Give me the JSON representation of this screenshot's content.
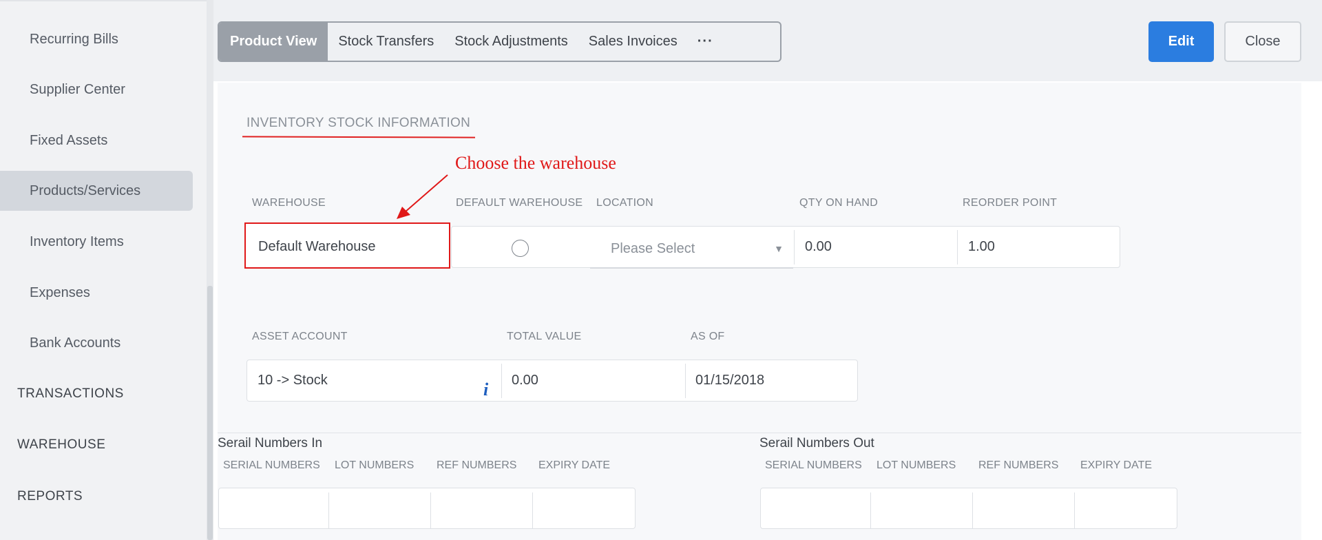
{
  "sidebar": {
    "items": [
      {
        "label": "Recurring Bills"
      },
      {
        "label": "Supplier Center"
      },
      {
        "label": "Fixed Assets"
      },
      {
        "label": "Products/Services"
      },
      {
        "label": "Inventory Items"
      },
      {
        "label": "Expenses"
      },
      {
        "label": "Bank Accounts"
      }
    ],
    "sections": [
      {
        "label": "TRANSACTIONS"
      },
      {
        "label": "WAREHOUSE"
      },
      {
        "label": "REPORTS"
      }
    ]
  },
  "tabs": [
    {
      "label": "Product View",
      "active": true
    },
    {
      "label": "Stock Transfers"
    },
    {
      "label": "Stock Adjustments"
    },
    {
      "label": "Sales Invoices"
    },
    {
      "label": "···"
    }
  ],
  "actions": {
    "edit_label": "Edit",
    "close_label": "Close"
  },
  "inventory": {
    "title": "INVENTORY STOCK INFORMATION",
    "annotation": "Choose the warehouse",
    "columns": {
      "warehouse": "WAREHOUSE",
      "default_warehouse": "DEFAULT WAREHOUSE",
      "location": "LOCATION",
      "qty_on_hand": "QTY ON HAND",
      "reorder_point": "REORDER POINT"
    },
    "row": {
      "warehouse": "Default Warehouse",
      "location_placeholder": "Please Select",
      "qty_on_hand": "0.00",
      "reorder_point": "1.00"
    },
    "account_columns": {
      "asset_account": "ASSET ACCOUNT",
      "total_value": "TOTAL VALUE",
      "as_of": "AS OF"
    },
    "account_row": {
      "asset_account": "10 -> Stock",
      "info_icon": "i",
      "total_value": "0.00",
      "as_of": "01/15/2018"
    }
  },
  "serials_in": {
    "title": "Serail Numbers In",
    "columns": [
      "SERIAL NUMBERS",
      "LOT NUMBERS",
      "REF NUMBERS",
      "EXPIRY DATE"
    ]
  },
  "serials_out": {
    "title": "Serail Numbers Out",
    "columns": [
      "SERIAL NUMBERS",
      "LOT NUMBERS",
      "REF NUMBERS",
      "EXPIRY DATE"
    ]
  }
}
